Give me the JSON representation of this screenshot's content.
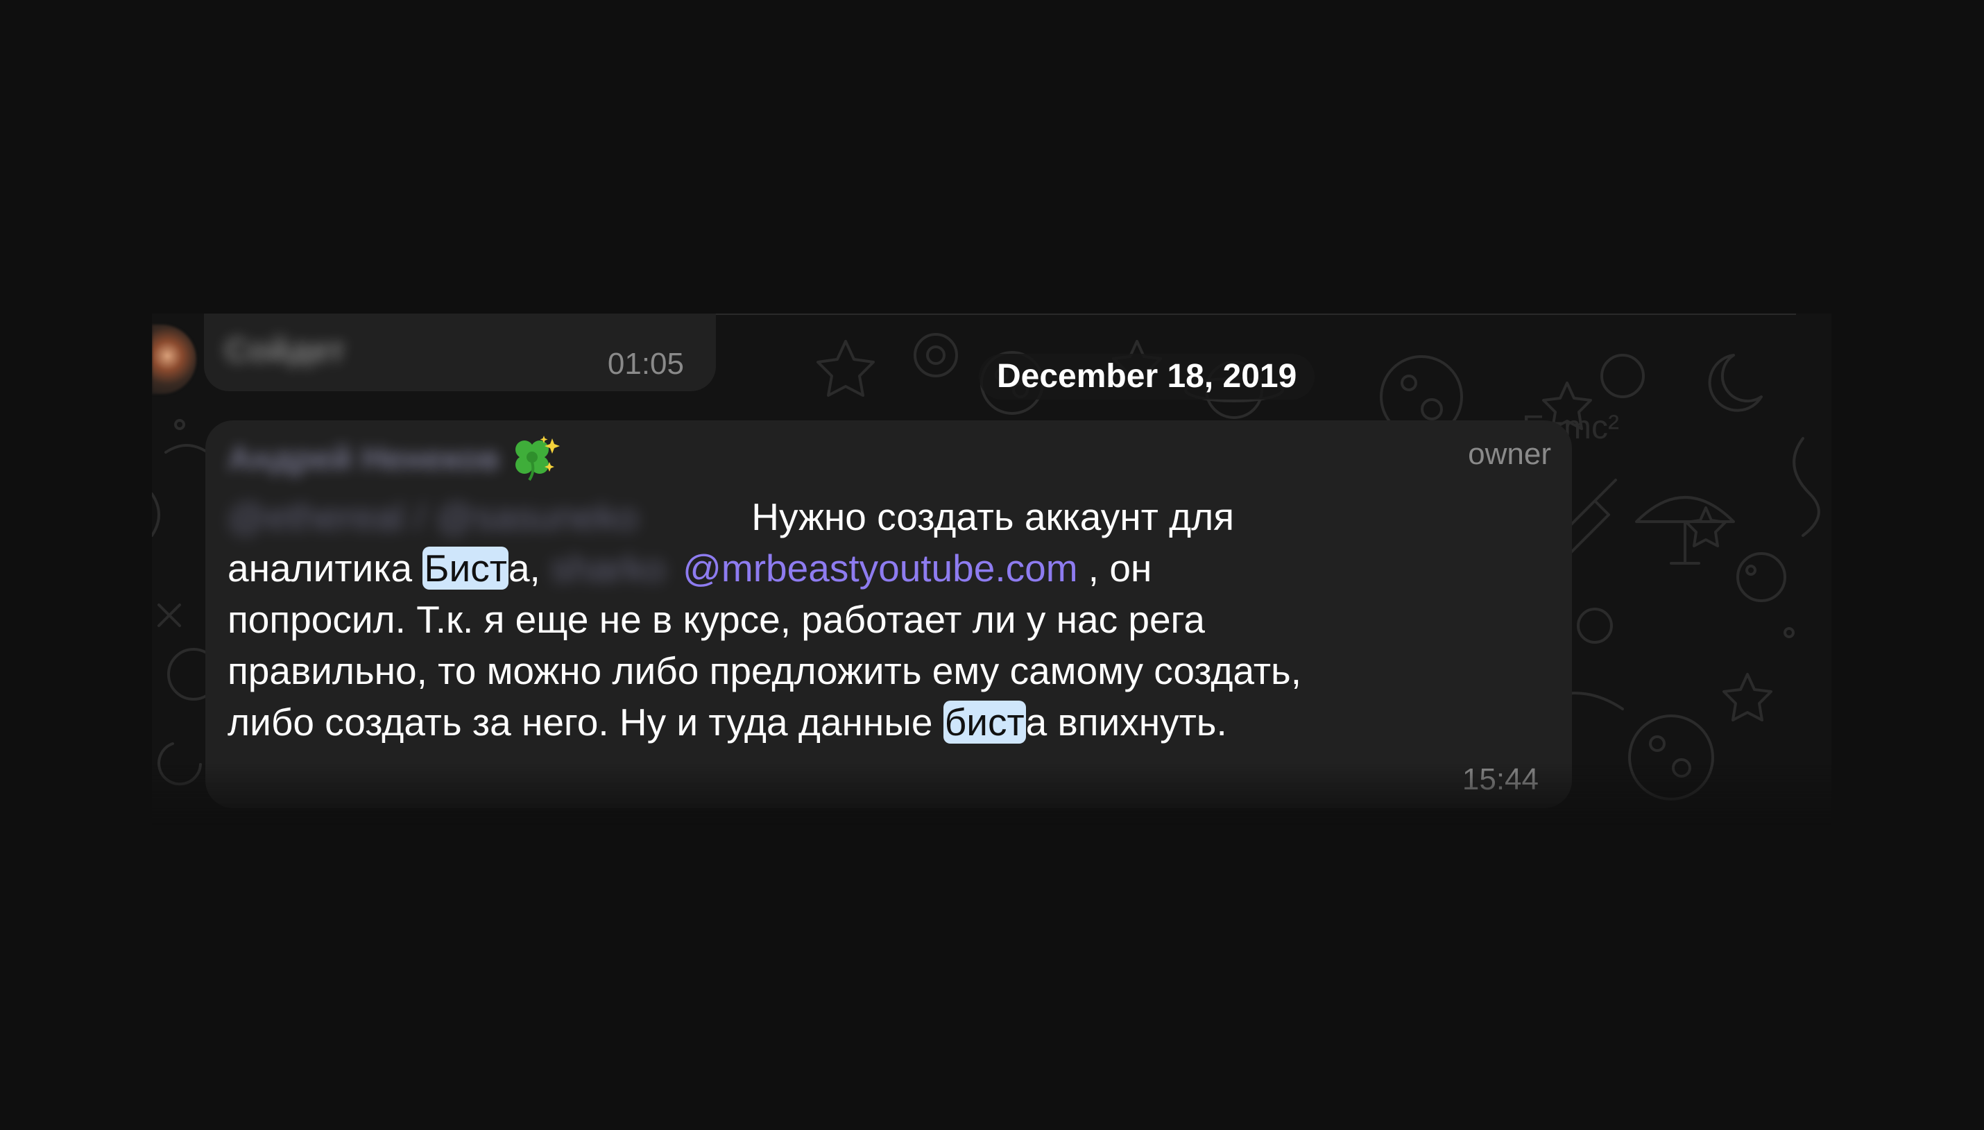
{
  "previous_message": {
    "text": "Сойдет",
    "time": "01:05"
  },
  "date_separator": "December 18, 2019",
  "message": {
    "sender_name": "Андрей Ненеков",
    "sender_emoji": "clover-sparkles-icon",
    "role": "owner",
    "segments": {
      "redacted_1": "@ethereal / @sasuneko",
      "line1_text": "Нужно создать аккаунт для",
      "line2_prefix": "аналитика ",
      "highlight_1": "Бист",
      "line2_after_highlight": "а, ",
      "redacted_2": "sharko",
      "mention": "@mrbeastyoutube.com",
      "line2_suffix": " , он",
      "line3": "попросил. Т.к. я еще не в курсе, работает ли у нас рега",
      "line4": "правильно, то можно либо предложить ему самому создать,",
      "line5_prefix": "либо создать за него. Ну и туда данные ",
      "highlight_2": "бист",
      "line5_suffix": "а впихнуть."
    },
    "time": "15:44"
  },
  "colors": {
    "background": "#0f0f0f",
    "bubble": "#212121",
    "mention": "#8e7cf0",
    "highlight": "#cfe6fb",
    "timestamp": "#8a8a8a"
  }
}
